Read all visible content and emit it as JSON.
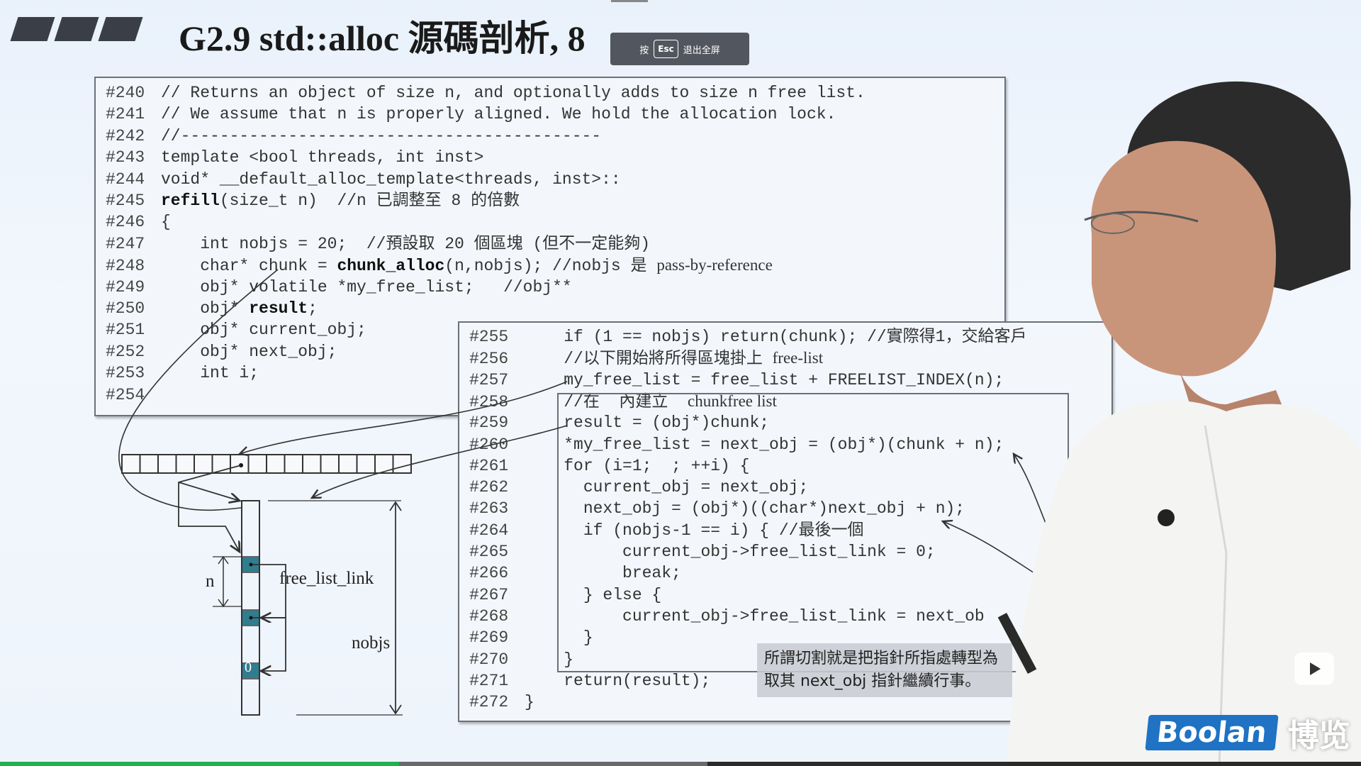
{
  "slide": {
    "title": "G2.9 std::alloc 源碼剖析, 8"
  },
  "fullscreen_hint": {
    "prefix": "按",
    "key": "Esc",
    "suffix": "退出全屏"
  },
  "code_top": [
    {
      "num": "#240",
      "code": "// Returns an object of size n, and optionally adds to size n free list."
    },
    {
      "num": "#241",
      "code": "// We assume that n is properly aligned. We hold the allocation lock."
    },
    {
      "num": "#242",
      "code": "//-------------------------------------------"
    },
    {
      "num": "#243",
      "code": "template <bool threads, int inst>"
    },
    {
      "num": "#244",
      "code": "void* __default_alloc_template<threads, inst>::"
    },
    {
      "num": "#245",
      "code_bold": "refill",
      "code": "(size_t n)  //n 已調整至 8 的倍數"
    },
    {
      "num": "#246",
      "code": "{"
    },
    {
      "num": "#247",
      "code": "    int nobjs = 20;  //預設取 20 個區塊 (但不一定能夠)"
    },
    {
      "num": "#248",
      "code_pre": "    char* chunk = ",
      "code_bold": "chunk_alloc",
      "code_mid": "(n,nobjs); //nobjs 是 ",
      "code_serif": "pass-by-reference"
    },
    {
      "num": "#249",
      "code": "    obj* volatile *my_free_list;   //obj**"
    },
    {
      "num": "#250",
      "code_pre": "    obj* ",
      "code_bold": "result",
      "code": ";"
    },
    {
      "num": "#251",
      "code": "    obj* current_obj;"
    },
    {
      "num": "#252",
      "code": "    obj* next_obj;"
    },
    {
      "num": "#253",
      "code": "    int i;"
    },
    {
      "num": "#254",
      "code": ""
    }
  ],
  "code_bottom": [
    {
      "num": "#255",
      "code": "    if (1 == nobjs) return(chunk); //實際得1，交給客戶"
    },
    {
      "num": "#256",
      "code_pre": "    //以下開始將所得區塊掛上 ",
      "code_serif": "free-list"
    },
    {
      "num": "#257",
      "code": "    my_free_list = free_list + FREELIST_INDEX(n);"
    },
    {
      "num": "#258",
      "code_pre": "    //在 ",
      "code_serif": "chunk",
      "code_mid": " 內建立  ",
      "code_serif2": "free list"
    },
    {
      "num": "#259",
      "code": "    result = (obj*)chunk;"
    },
    {
      "num": "#260",
      "code": "    *my_free_list = next_obj = (obj*)(chunk + n);"
    },
    {
      "num": "#261",
      "code": "    for (i=1;  ; ++i) {"
    },
    {
      "num": "#262",
      "code": "      current_obj = next_obj;"
    },
    {
      "num": "#263",
      "code": "      next_obj = (obj*)((char*)next_obj + n);"
    },
    {
      "num": "#264",
      "code": "      if (nobjs-1 == i) { //最後一個"
    },
    {
      "num": "#265",
      "code": "          current_obj->free_list_link = 0;"
    },
    {
      "num": "#266",
      "code": "          break;"
    },
    {
      "num": "#267",
      "code": "      } else {"
    },
    {
      "num": "#268",
      "code": "          current_obj->free_list_link = next_ob"
    },
    {
      "num": "#269",
      "code": "      }"
    },
    {
      "num": "#270",
      "code": "    }"
    },
    {
      "num": "#271",
      "code": "    return(result);"
    },
    {
      "num": "#272",
      "code": "}"
    }
  ],
  "diagram": {
    "label_n": "n",
    "label_free_list_link": "free_list_link",
    "label_nobjs": "nobjs",
    "label_zero": "0"
  },
  "note": {
    "line1": "所謂切割就是把指針所指處轉型為",
    "line2": "取其 next_obj 指針繼續行事。"
  },
  "brand": {
    "logo": "Boolan",
    "name": "博览"
  },
  "player": {
    "progress_fraction": 0.293,
    "buffer_fraction": 0.52
  },
  "colors": {
    "accent_blue": "#1f72c4",
    "progress_green": "#1fb14e",
    "block_teal": "#2f7d8f"
  }
}
